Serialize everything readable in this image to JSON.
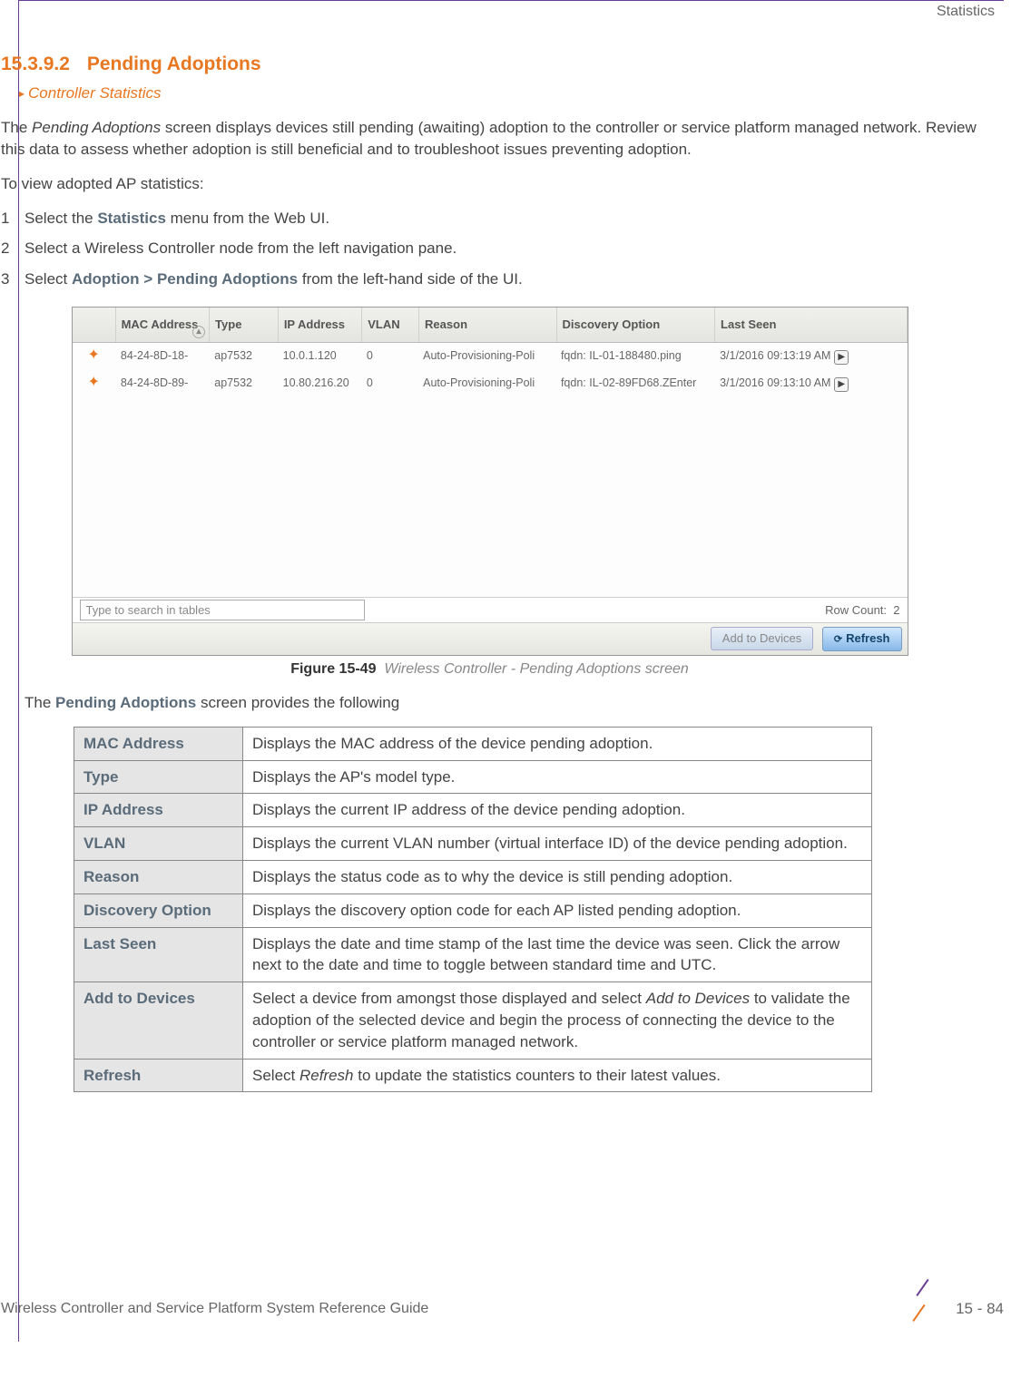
{
  "header": {
    "breadcrumb_right": "Statistics"
  },
  "section": {
    "number": "15.3.9.2",
    "title": "Pending Adoptions",
    "link": "Controller Statistics"
  },
  "intro": "The Pending Adoptions screen displays devices still pending (awaiting) adoption to the controller or service platform managed network. Review this data to assess whether adoption is still beneficial and to troubleshoot issues preventing adoption.",
  "lead": "To view adopted AP statistics:",
  "steps": {
    "s1_pre": "Select the ",
    "s1_bold": "Statistics",
    "s1_post": " menu from the Web UI.",
    "s2": "Select a Wireless Controller node from the left navigation pane.",
    "s3_pre": "Select ",
    "s3_bold": "Adoption > Pending Adoptions",
    "s3_post": " from the left-hand side of the UI."
  },
  "ui": {
    "headers": {
      "mac": "MAC Address",
      "type": "Type",
      "ip": "IP Address",
      "vlan": "VLAN",
      "reason": "Reason",
      "disc": "Discovery Option",
      "last": "Last Seen"
    },
    "rows": [
      {
        "mac": "84-24-8D-18-",
        "type": "ap7532",
        "ip": "10.0.1.120",
        "vlan": "0",
        "reason": "Auto-Provisioning-Poli",
        "disc": "fqdn: IL-01-188480.ping",
        "last": "3/1/2016 09:13:19 AM"
      },
      {
        "mac": "84-24-8D-89-",
        "type": "ap7532",
        "ip": "10.80.216.20",
        "vlan": "0",
        "reason": "Auto-Provisioning-Poli",
        "disc": "fqdn: IL-02-89FD68.ZEnter",
        "last": "3/1/2016 09:13:10 AM"
      }
    ],
    "search_placeholder": "Type to search in tables",
    "row_count_label": "Row Count:",
    "row_count_value": "2",
    "btn_add": "Add to Devices",
    "btn_refresh": "Refresh"
  },
  "figure": {
    "num": "Figure 15-49",
    "text": "Wireless Controller - Pending Adoptions screen"
  },
  "table_intro_pre": "The ",
  "table_intro_bold": "Pending Adoptions",
  "table_intro_post": " screen provides the following",
  "fields": [
    {
      "label": "MAC Address",
      "desc": "Displays the MAC address of the device pending adoption."
    },
    {
      "label": "Type",
      "desc": "Displays the AP's model type."
    },
    {
      "label": "IP Address",
      "desc": "Displays the current IP address of the device pending adoption."
    },
    {
      "label": "VLAN",
      "desc": "Displays the current VLAN number (virtual interface ID) of the device pending adoption."
    },
    {
      "label": "Reason",
      "desc": "Displays the status code as to why the device is still pending adoption."
    },
    {
      "label": "Discovery Option",
      "desc": "Displays the discovery option code for each AP listed pending adoption."
    },
    {
      "label": "Last Seen",
      "desc": "Displays the date and time stamp of the last time the device was seen. Click the arrow next to the date and time to toggle between standard time and UTC."
    },
    {
      "label": "Add to Devices",
      "desc": "Select a device from amongst those displayed and select Add to Devices to validate the adoption of the selected device and begin the process of connecting the device to the controller or service platform managed network."
    },
    {
      "label": "Refresh",
      "desc": "Select Refresh to update the statistics counters to their latest values."
    }
  ],
  "footer": {
    "left": "Wireless Controller and Service Platform System Reference Guide",
    "page": "15 - 84"
  }
}
